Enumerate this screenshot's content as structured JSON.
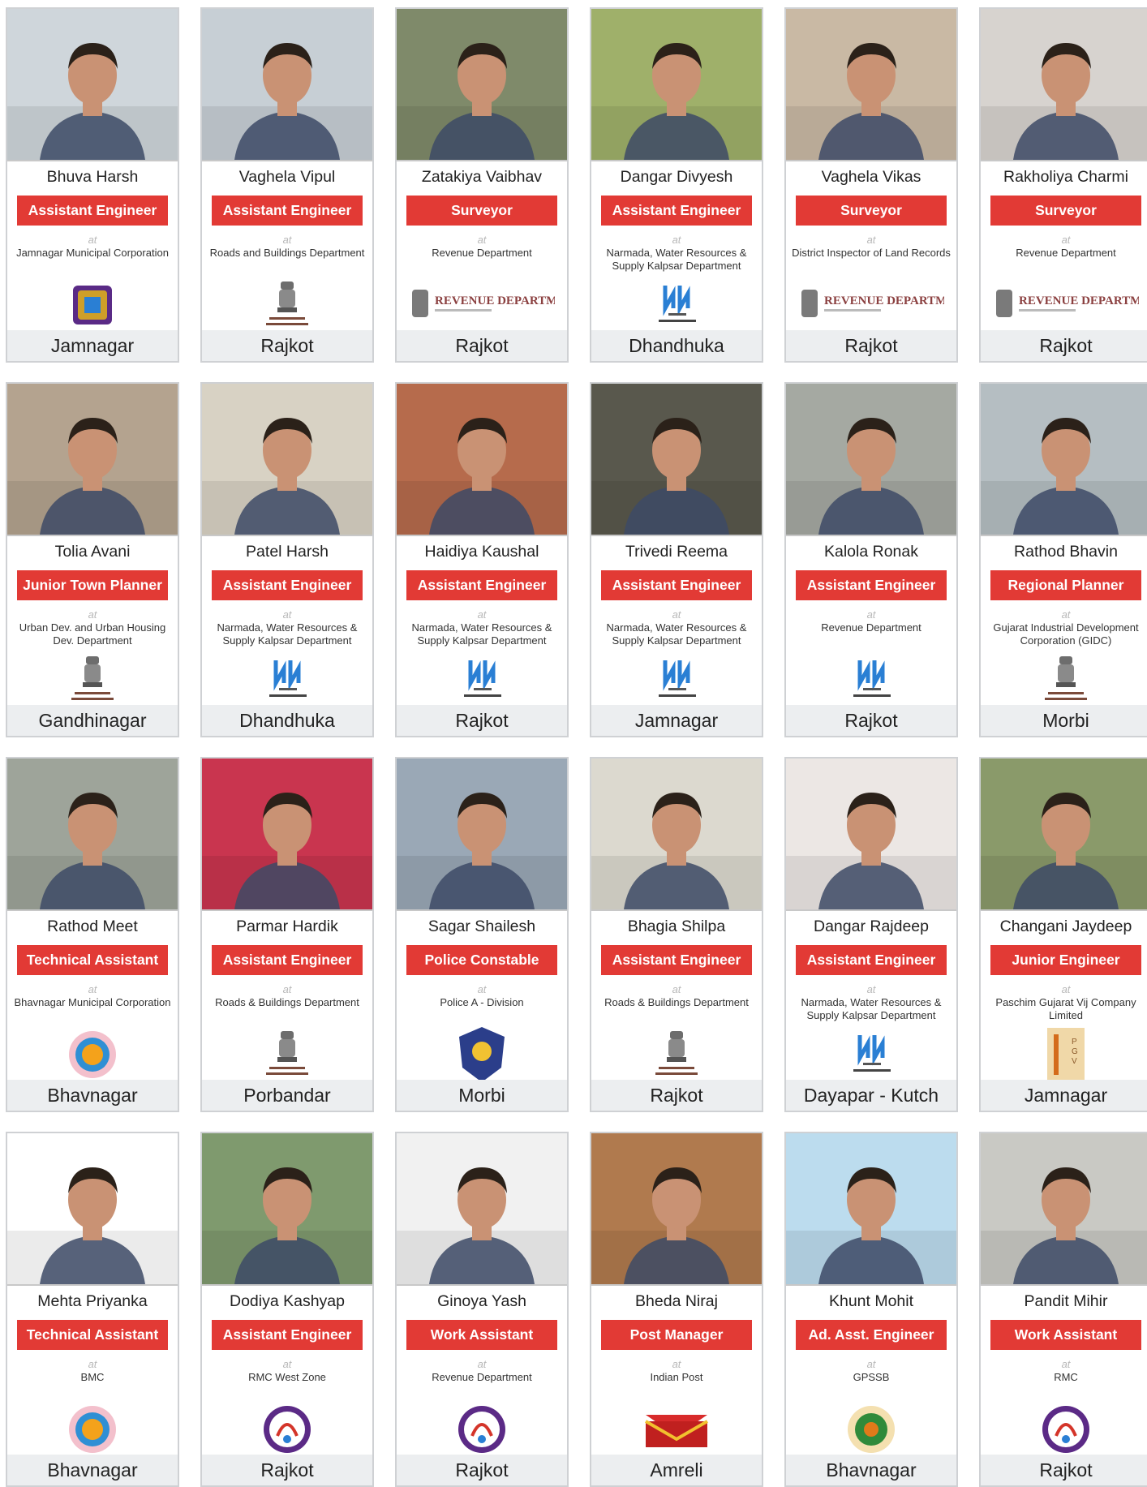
{
  "at_label": "at",
  "cards": [
    {
      "name": "Bhuva Harsh",
      "role": "Assistant Engineer",
      "org": "Jamnagar Municipal Corporation",
      "logo": "jmc-logo",
      "city": "Jamnagar",
      "tone": "#cfd6db"
    },
    {
      "name": "Vaghela Vipul",
      "role": "Assistant Engineer",
      "org": "Roads and Buildings Department",
      "logo": "emblem-logo",
      "city": "Rajkot",
      "tone": "#c7cfd5"
    },
    {
      "name": "Zatakiya Vaibhav",
      "role": "Surveyor",
      "org": "Revenue Department",
      "logo": "revenue-banner-logo",
      "city": "Rajkot",
      "tone": "#7f8a6a"
    },
    {
      "name": "Dangar Divyesh",
      "role": "Assistant Engineer",
      "org": "Narmada, Water Resources & Supply Kalpsar Department",
      "logo": "narmada-logo",
      "city": "Dhandhuka",
      "tone": "#9fb06a"
    },
    {
      "name": "Vaghela Vikas",
      "role": "Surveyor",
      "org": "District Inspector of Land Records",
      "logo": "revenue-banner-logo",
      "city": "Rajkot",
      "tone": "#c9b9a4"
    },
    {
      "name": "Rakholiya Charmi",
      "role": "Surveyor",
      "org": "Revenue Department",
      "logo": "revenue-banner-logo",
      "city": "Rajkot",
      "tone": "#d7d3cf"
    },
    {
      "name": "Tolia Avani",
      "role": "Junior Town Planner",
      "org": "Urban Dev. and Urban Housing Dev. Department",
      "logo": "emblem-logo",
      "city": "Gandhinagar",
      "tone": "#b4a38f"
    },
    {
      "name": "Patel Harsh",
      "role": "Assistant Engineer",
      "org": "Narmada, Water Resources & Supply Kalpsar Department",
      "logo": "narmada-logo",
      "city": "Dhandhuka",
      "tone": "#d8d2c4"
    },
    {
      "name": "Haidiya Kaushal",
      "role": "Assistant Engineer",
      "org": "Narmada, Water Resources & Supply Kalpsar Department",
      "logo": "narmada-logo",
      "city": "Rajkot",
      "tone": "#b66b4c"
    },
    {
      "name": "Trivedi Reema",
      "role": "Assistant Engineer",
      "org": "Narmada, Water Resources & Supply Kalpsar Department",
      "logo": "narmada-logo",
      "city": "Jamnagar",
      "tone": "#59584d"
    },
    {
      "name": "Kalola Ronak",
      "role": "Assistant Engineer",
      "org": "Revenue Department",
      "logo": "narmada-logo",
      "city": "Rajkot",
      "tone": "#a5a9a2"
    },
    {
      "name": "Rathod Bhavin",
      "role": "Regional Planner",
      "org": "Gujarat Industrial Development Corporation (GIDC)",
      "logo": "emblem-logo",
      "city": "Morbi",
      "tone": "#b5bec2"
    },
    {
      "name": "Rathod Meet",
      "role": "Technical Assistant",
      "org": "Bhavnagar Municipal Corporation",
      "logo": "bmc-logo",
      "city": "Bhavnagar",
      "tone": "#9ea49a"
    },
    {
      "name": "Parmar Hardik",
      "role": "Assistant Engineer",
      "org": "Roads & Buildings Department",
      "logo": "emblem-logo",
      "city": "Porbandar",
      "tone": "#c9354f"
    },
    {
      "name": "Sagar Shailesh",
      "role": "Police Constable",
      "org": "Police A - Division",
      "logo": "police-logo",
      "city": "Morbi",
      "tone": "#9aa8b6"
    },
    {
      "name": "Bhagia Shilpa",
      "role": "Assistant Engineer",
      "org": "Roads & Buildings Department",
      "logo": "emblem-logo",
      "city": "Rajkot",
      "tone": "#dcd9cf"
    },
    {
      "name": "Dangar Rajdeep",
      "role": "Assistant Engineer",
      "org": "Narmada, Water Resources & Supply Kalpsar Department",
      "logo": "narmada-logo",
      "city": "Dayapar - Kutch",
      "tone": "#ece7e4"
    },
    {
      "name": "Changani Jaydeep",
      "role": "Junior Engineer",
      "org": "Paschim Gujarat Vij Company Limited",
      "logo": "pgvcl-logo",
      "city": "Jamnagar",
      "tone": "#8a9a6a"
    },
    {
      "name": "Mehta Priyanka",
      "role": "Technical Assistant",
      "org": "BMC",
      "logo": "bmc-logo",
      "city": "Bhavnagar",
      "tone": "#ffffff"
    },
    {
      "name": "Dodiya Kashyap",
      "role": "Assistant Engineer",
      "org": "RMC West Zone",
      "logo": "rmc-logo",
      "city": "Rajkot",
      "tone": "#7f9a6e"
    },
    {
      "name": "Ginoya Yash",
      "role": "Work Assistant",
      "org": "Revenue Department",
      "logo": "rmc-logo",
      "city": "Rajkot",
      "tone": "#f1f1f1"
    },
    {
      "name": "Bheda Niraj",
      "role": "Post Manager",
      "org": "Indian Post",
      "logo": "indiapost-logo",
      "city": "Amreli",
      "tone": "#b07a4e"
    },
    {
      "name": "Khunt Mohit",
      "role": "Ad. Asst. Engineer",
      "org": "GPSSB",
      "logo": "gpssb-logo",
      "city": "Bhavnagar",
      "tone": "#bcdcee"
    },
    {
      "name": "Pandit Mihir",
      "role": "Work Assistant",
      "org": "RMC",
      "logo": "rmc-logo",
      "city": "Rajkot",
      "tone": "#c9c9c4"
    }
  ]
}
